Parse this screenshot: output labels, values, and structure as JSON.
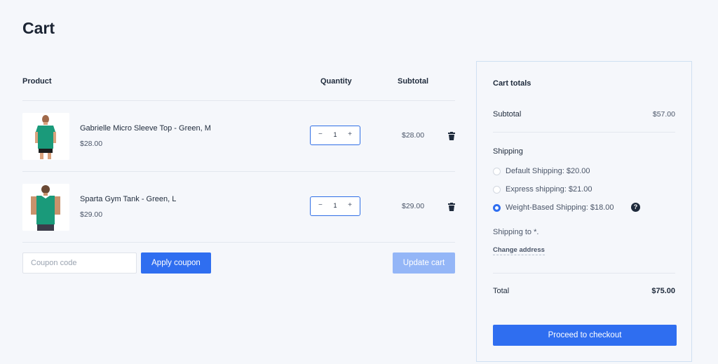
{
  "page": {
    "title": "Cart"
  },
  "table": {
    "headers": {
      "product": "Product",
      "quantity": "Quantity",
      "subtotal": "Subtotal"
    },
    "items": [
      {
        "name": "Gabrielle Micro Sleeve Top - Green, M",
        "price": "$28.00",
        "quantity": "1",
        "subtotal": "$28.00",
        "image_icon": "tshirt-green-icon"
      },
      {
        "name": "Sparta Gym Tank - Green, L",
        "price": "$29.00",
        "quantity": "1",
        "subtotal": "$29.00",
        "image_icon": "tank-green-icon"
      }
    ],
    "minus_symbol": "−",
    "plus_symbol": "+"
  },
  "coupon": {
    "placeholder": "Coupon code",
    "apply_label": "Apply coupon"
  },
  "update_label": "Update cart",
  "totals": {
    "title": "Cart totals",
    "subtotal_label": "Subtotal",
    "subtotal_value": "$57.00",
    "shipping_label": "Shipping",
    "options": [
      {
        "label": "Default Shipping: $20.00",
        "selected": false
      },
      {
        "label": "Express shipping: $21.00",
        "selected": false
      },
      {
        "label": "Weight-Based Shipping: $18.00",
        "selected": true
      }
    ],
    "help_symbol": "?",
    "shipping_to": "Shipping to *.",
    "change_address": "Change address",
    "total_label": "Total",
    "total_value": "$75.00",
    "checkout_label": "Proceed to checkout"
  },
  "colors": {
    "accent": "#2f6ef0",
    "accent_disabled": "#94b6f7",
    "product_green": "#1a9a7a"
  }
}
